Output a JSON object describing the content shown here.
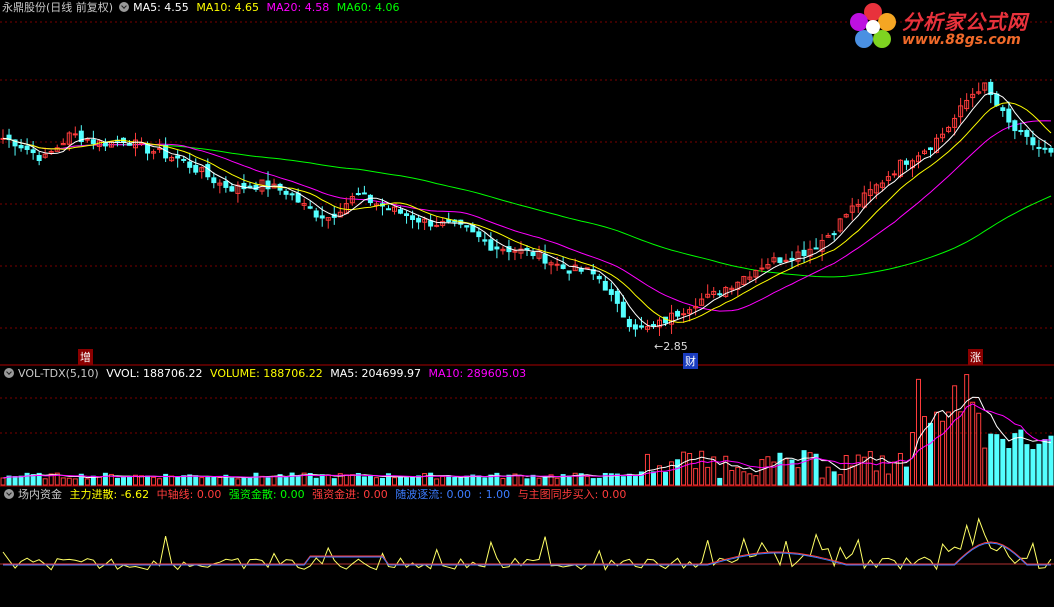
{
  "main_header": {
    "stock": "永鼎股份(日线 前复权)",
    "ma5": "MA5: 4.55",
    "ma10": "MA10: 4.65",
    "ma20": "MA20: 4.58",
    "ma60": "MA60: 4.06"
  },
  "vol_header": {
    "name": "VOL-TDX(5,10)",
    "vvol": "VVOL: 188706.22",
    "volume": "VOLUME: 188706.22",
    "ma5": "MA5: 204699.97",
    "ma10": "MA10: 289605.03"
  },
  "ind_header": {
    "name": "场内资金",
    "zljs": "主力进散: -6.62",
    "zzx": "中轴线: 0.00",
    "qzjs": "强资金散: 0.00",
    "qzjj": "强资金进: 0.00",
    "sbzl": "随波逐流: 0.00",
    "one": ": 1.00",
    "ytb": "与主图同步买入: 0.00"
  },
  "logo": {
    "title": "分析家公式网",
    "url": "www.88gs.com"
  },
  "markers": {
    "zeng": "增",
    "cai": "财",
    "zhang": "涨",
    "low": "2.85"
  },
  "colors": {
    "up": "#ff3c3c",
    "down": "#54ffff",
    "ma5": "#ffffff",
    "ma10": "#ffff00",
    "ma20": "#ff00ff",
    "ma60": "#00ff00",
    "grid": "#7a0000",
    "axis": "#aa0000"
  },
  "chart_data": {
    "type": "candlestick",
    "title": "永鼎股份(日线 前复权)",
    "y_range_price": [
      2.7,
      6.3
    ],
    "closes": [
      5.3,
      5.25,
      5.15,
      5.05,
      5.2,
      5.35,
      5.3,
      5.25,
      5.25,
      5.3,
      5.2,
      5.15,
      5.1,
      5.05,
      4.95,
      4.85,
      4.75,
      4.7,
      4.72,
      4.75,
      4.7,
      4.65,
      4.5,
      4.4,
      4.35,
      4.5,
      4.62,
      4.55,
      4.48,
      4.42,
      4.36,
      4.3,
      4.28,
      4.25,
      4.2,
      4.1,
      4.0,
      3.98,
      3.95,
      3.92,
      3.85,
      3.75,
      3.72,
      3.7,
      3.6,
      3.3,
      3.1,
      3.0,
      3.05,
      3.15,
      3.25,
      3.35,
      3.4,
      3.5,
      3.6,
      3.7,
      3.8,
      3.85,
      3.9,
      3.95,
      4.05,
      4.2,
      4.4,
      4.55,
      4.7,
      4.85,
      5.0,
      5.1,
      5.2,
      5.35,
      5.55,
      5.8,
      5.95,
      5.7,
      5.45,
      5.3,
      5.2,
      5.1
    ],
    "volume_range": [
      0,
      2000000
    ]
  }
}
